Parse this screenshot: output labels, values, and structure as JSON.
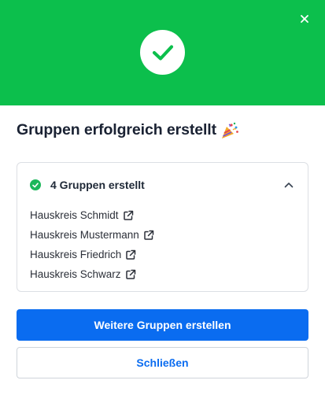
{
  "header": {
    "bg_color": "#0cbf4c",
    "close_icon": "close-icon",
    "status_icon": "checkmark-icon"
  },
  "title": {
    "text": "Gruppen erfolgreich erstellt",
    "emoji_icon": "party-popper-icon"
  },
  "summary_panel": {
    "summary_label": "4 Gruppen erstellt",
    "expanded": true,
    "items": [
      {
        "label": "Hauskreis Schmidt"
      },
      {
        "label": "Hauskreis Mustermann"
      },
      {
        "label": "Hauskreis Friedrich"
      },
      {
        "label": "Hauskreis Schwarz"
      }
    ]
  },
  "actions": {
    "primary_label": "Weitere Gruppen erstellen",
    "secondary_label": "Schließen",
    "accent_color": "#0a6cf0"
  }
}
